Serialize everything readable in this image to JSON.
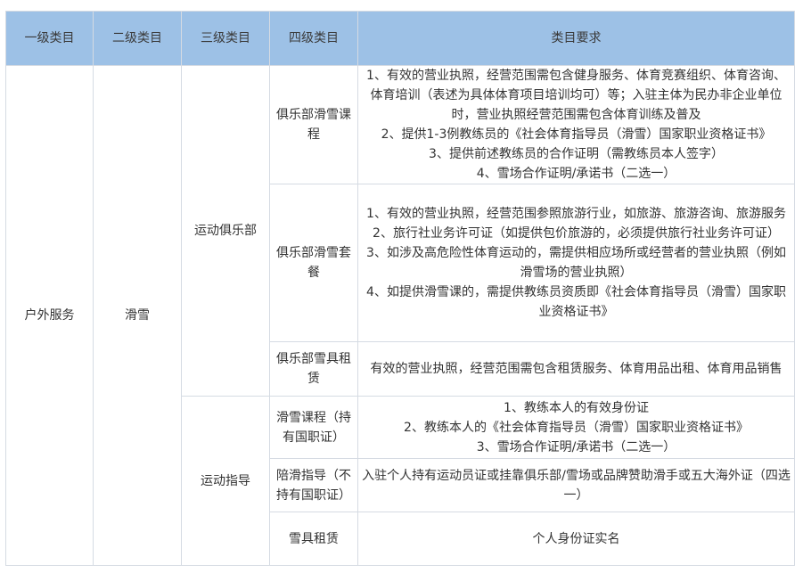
{
  "headers": [
    "一级类目",
    "二级类目",
    "三级类目",
    "四级类目",
    "类目要求"
  ],
  "level1": "户外服务",
  "level2": "滑雪",
  "groups": [
    {
      "level3": "运动俱乐部",
      "rows": [
        {
          "level4": "俱乐部滑雪课程",
          "requirements": [
            "1、有效的营业执照，经营范围需包含健身服务、体育竞赛组织、体育咨询、体育培训（表述为具体体育项目培训均可）等；入驻主体为民办非企业单位时，营业执照经营范围需包含体育训练及普及",
            "2、提供1-3例教练员的《社会体育指导员（滑雪）国家职业资格证书》",
            "3、提供前述教练员的合作证明（需教练员本人签字）",
            "4、雪场合作证明/承诺书（二选一）"
          ]
        },
        {
          "level4": "俱乐部滑雪套餐",
          "requirements": [
            "1、有效的营业执照，经营范围参照旅游行业，如旅游、旅游咨询、旅游服务",
            "2、旅行社业务许可证（如提供包价旅游的，必须提供旅行社业务许可证）",
            "3、如涉及高危险性体育运动的，需提供相应场所或经营者的营业执照（例如滑雪场的营业执照）",
            "4、如提供滑雪课的，需提供教练员资质即《社会体育指导员（滑雪）国家职业资格证书》"
          ]
        },
        {
          "level4": "俱乐部雪具租赁",
          "requirements": [
            "有效的营业执照，经营范围需包含租赁服务、体育用品出租、体育用品销售"
          ]
        }
      ]
    },
    {
      "level3": "运动指导",
      "rows": [
        {
          "level4": "滑雪课程（持有国职证）",
          "requirements": [
            "1、教练本人的有效身份证",
            "2、教练本人的《社会体育指导员（滑雪）国家职业资格证书》",
            "3、雪场合作证明/承诺书（二选一）"
          ]
        },
        {
          "level4": "陪滑指导（不持有国职证）",
          "requirements": [
            "入驻个人持有运动员证或挂靠俱乐部/雪场或品牌赞助滑手或五大海外证（四选一）"
          ]
        },
        {
          "level4": "雪具租赁",
          "requirements": [
            "个人身份证实名"
          ]
        }
      ]
    }
  ]
}
